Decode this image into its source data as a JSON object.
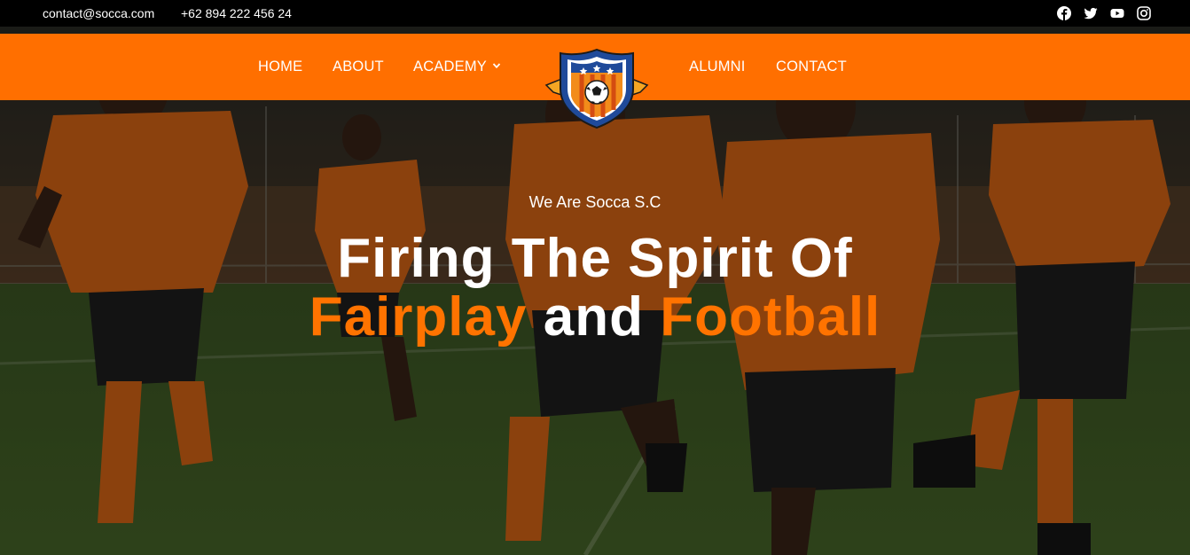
{
  "topbar": {
    "email": "contact@socca.com",
    "phone": "+62 894 222 456 24",
    "socials": [
      "facebook-icon",
      "twitter-icon",
      "youtube-icon",
      "instagram-icon"
    ]
  },
  "nav": {
    "home": "HOME",
    "about": "ABOUT",
    "academy": "ACADEMY",
    "alumni": "ALUMNI",
    "contact": "CONTACT"
  },
  "hero": {
    "tagline": "We Are Socca S.C",
    "headline_line1": "Firing The Spirit Of",
    "headline_word1": "Fairplay",
    "headline_word2": "and",
    "headline_word3": "Football"
  },
  "colors": {
    "brand_orange": "#ff6f00",
    "accent_orange": "#ff7300",
    "topbar_bg": "#000000",
    "shield_blue": "#1f4a9a"
  }
}
